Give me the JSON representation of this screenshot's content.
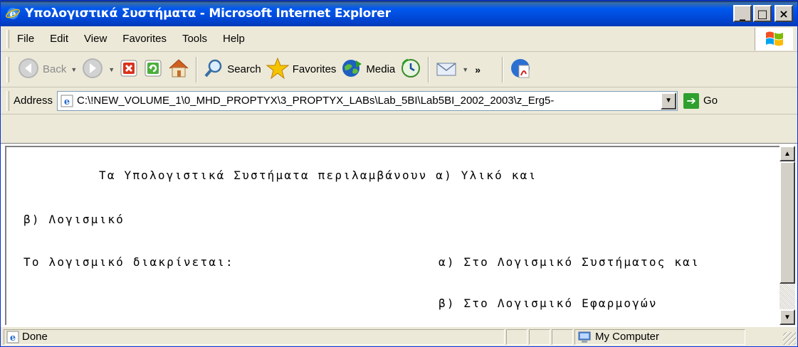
{
  "window": {
    "title": "Υπολογιστικά Συστήματα - Microsoft Internet Explorer",
    "controls": {
      "minimize": "_",
      "maximize": "□",
      "close": "×"
    }
  },
  "menu": {
    "items": [
      "File",
      "Edit",
      "View",
      "Favorites",
      "Tools",
      "Help"
    ]
  },
  "toolbar": {
    "back_label": "Back",
    "search_label": "Search",
    "favorites_label": "Favorites",
    "media_label": "Media",
    "more_label": "»"
  },
  "address": {
    "label": "Address",
    "value": "C:\\!NEW_VOLUME_1\\0_MHD_PROPTYX\\3_PROPTYX_LABs\\Lab_5BI\\Lab5BI_2002_2003\\z_Erg5-",
    "go_label": "Go"
  },
  "document": {
    "line1": "Τα Υπολογιστικά Συστήματα περιλαμβάνουν α)  Υλικό  και",
    "line2": "β) Λογισμικό",
    "line3_left": "Το λογισμικό διακρίνεται:",
    "line3_right": "α) Στο Λογισμικό Συστήματος και",
    "line4_right": "β) Στο Λογισμικό Εφαρμογών"
  },
  "status": {
    "text": "Done",
    "zone": "My Computer"
  },
  "icons": {
    "ie": "ie-logo-icon",
    "back": "back-arrow-icon",
    "forward": "forward-arrow-icon",
    "stop": "stop-icon",
    "refresh": "refresh-icon",
    "home": "home-icon",
    "search": "search-magnifier-icon",
    "favorites": "favorites-star-icon",
    "media": "media-globe-icon",
    "history": "history-icon",
    "mail": "mail-icon",
    "pdf": "pdf-icon",
    "windows_flag": "windows-flag-icon",
    "computer": "my-computer-icon"
  },
  "colors": {
    "titlebar": "#0058ee",
    "window_bg": "#ece9d8",
    "go_green": "#2ea02e"
  }
}
